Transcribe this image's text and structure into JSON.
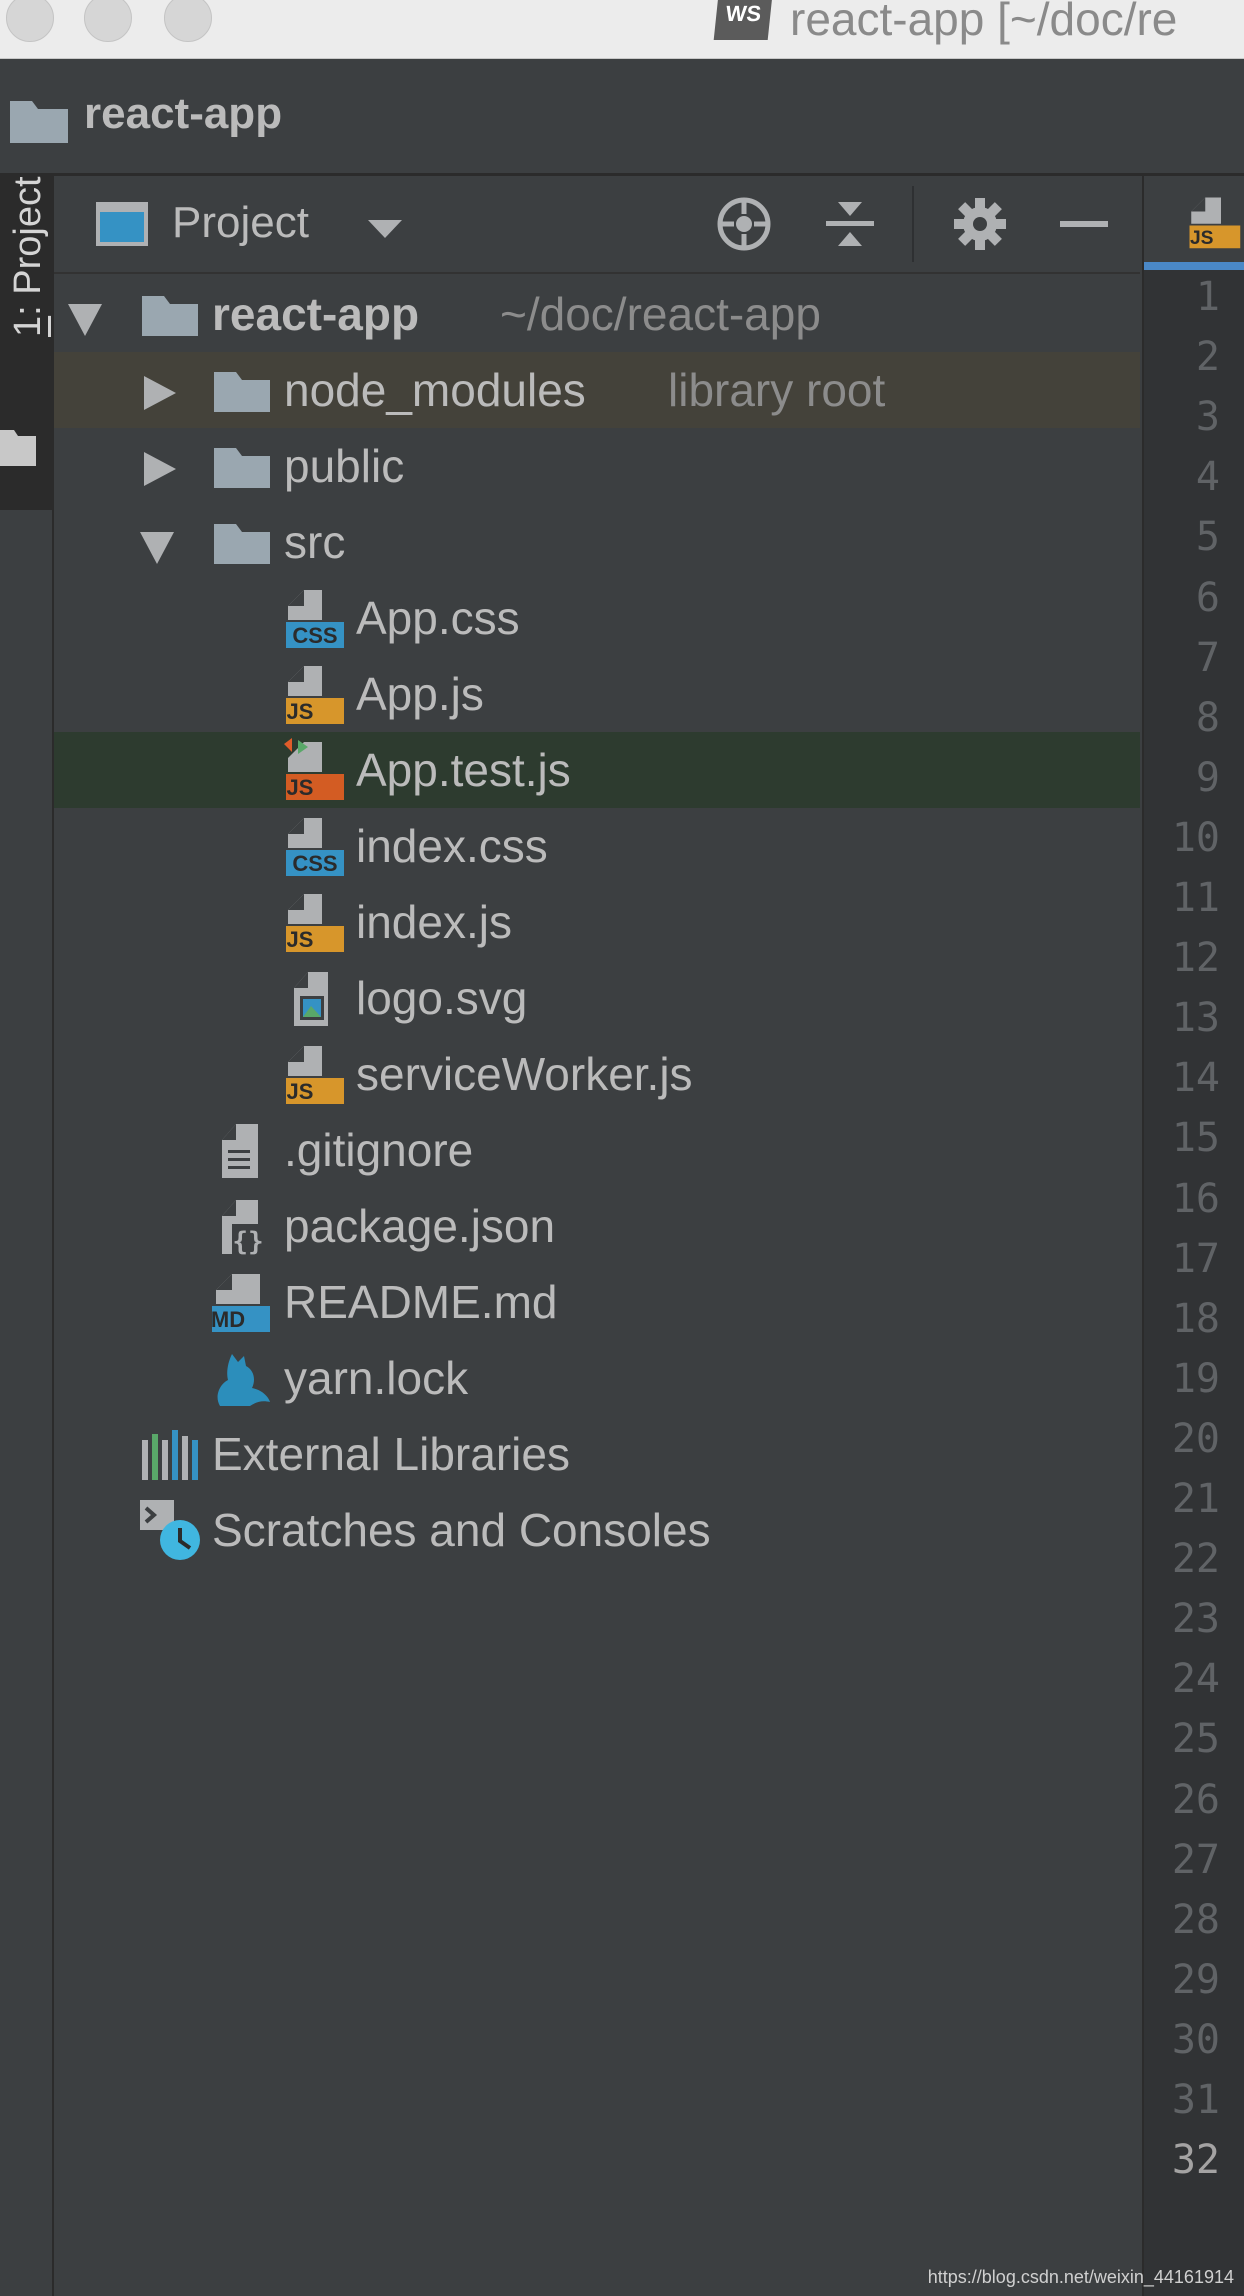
{
  "window": {
    "title": "react-app [~/doc/re",
    "logo_text": "WS"
  },
  "navbar": {
    "title": "react-app"
  },
  "toolstrip": {
    "project_number": "1",
    "project_label": ": Project"
  },
  "panel": {
    "view_label": "Project",
    "buttons": [
      "locate-icon",
      "collapse-all-icon",
      "gear-icon",
      "hide-icon"
    ]
  },
  "tree": {
    "root": {
      "name": "react-app",
      "path": "~/doc/react-app"
    },
    "node_modules": {
      "name": "node_modules",
      "hint": "library root"
    },
    "public": {
      "name": "public"
    },
    "src": {
      "name": "src"
    },
    "files": [
      {
        "name": "App.css",
        "type": "css"
      },
      {
        "name": "App.js",
        "type": "js"
      },
      {
        "name": "App.test.js",
        "type": "test"
      },
      {
        "name": "index.css",
        "type": "css"
      },
      {
        "name": "index.js",
        "type": "js"
      },
      {
        "name": "logo.svg",
        "type": "svg"
      },
      {
        "name": "serviceWorker.js",
        "type": "js"
      }
    ],
    "root_files": [
      {
        "name": ".gitignore",
        "type": "text"
      },
      {
        "name": "package.json",
        "type": "json"
      },
      {
        "name": "README.md",
        "type": "md"
      },
      {
        "name": "yarn.lock",
        "type": "yarn"
      }
    ],
    "external_libraries": "External Libraries",
    "scratches": "Scratches and Consoles"
  },
  "badges": {
    "css": "CSS",
    "js": "JS",
    "md": "MD"
  },
  "gutter": {
    "line_numbers": [
      "1",
      "2",
      "3",
      "4",
      "5",
      "6",
      "7",
      "8",
      "9",
      "10",
      "11",
      "12",
      "13",
      "14",
      "15",
      "16",
      "17",
      "18",
      "19",
      "20",
      "21",
      "22",
      "23",
      "24",
      "25",
      "26",
      "27",
      "28",
      "29",
      "30",
      "31",
      "32"
    ],
    "current_line": "32"
  },
  "watermark": "https://blog.csdn.net/weixin_44161914",
  "colors": {
    "panel_bg": "#3c3f41",
    "library_row": "#44423a",
    "selected_row": "#2d3b2f",
    "css_badge": "#3592c4",
    "js_badge": "#d7962b",
    "test_badge": "#d35c23",
    "folder": "#9aa7b0"
  }
}
